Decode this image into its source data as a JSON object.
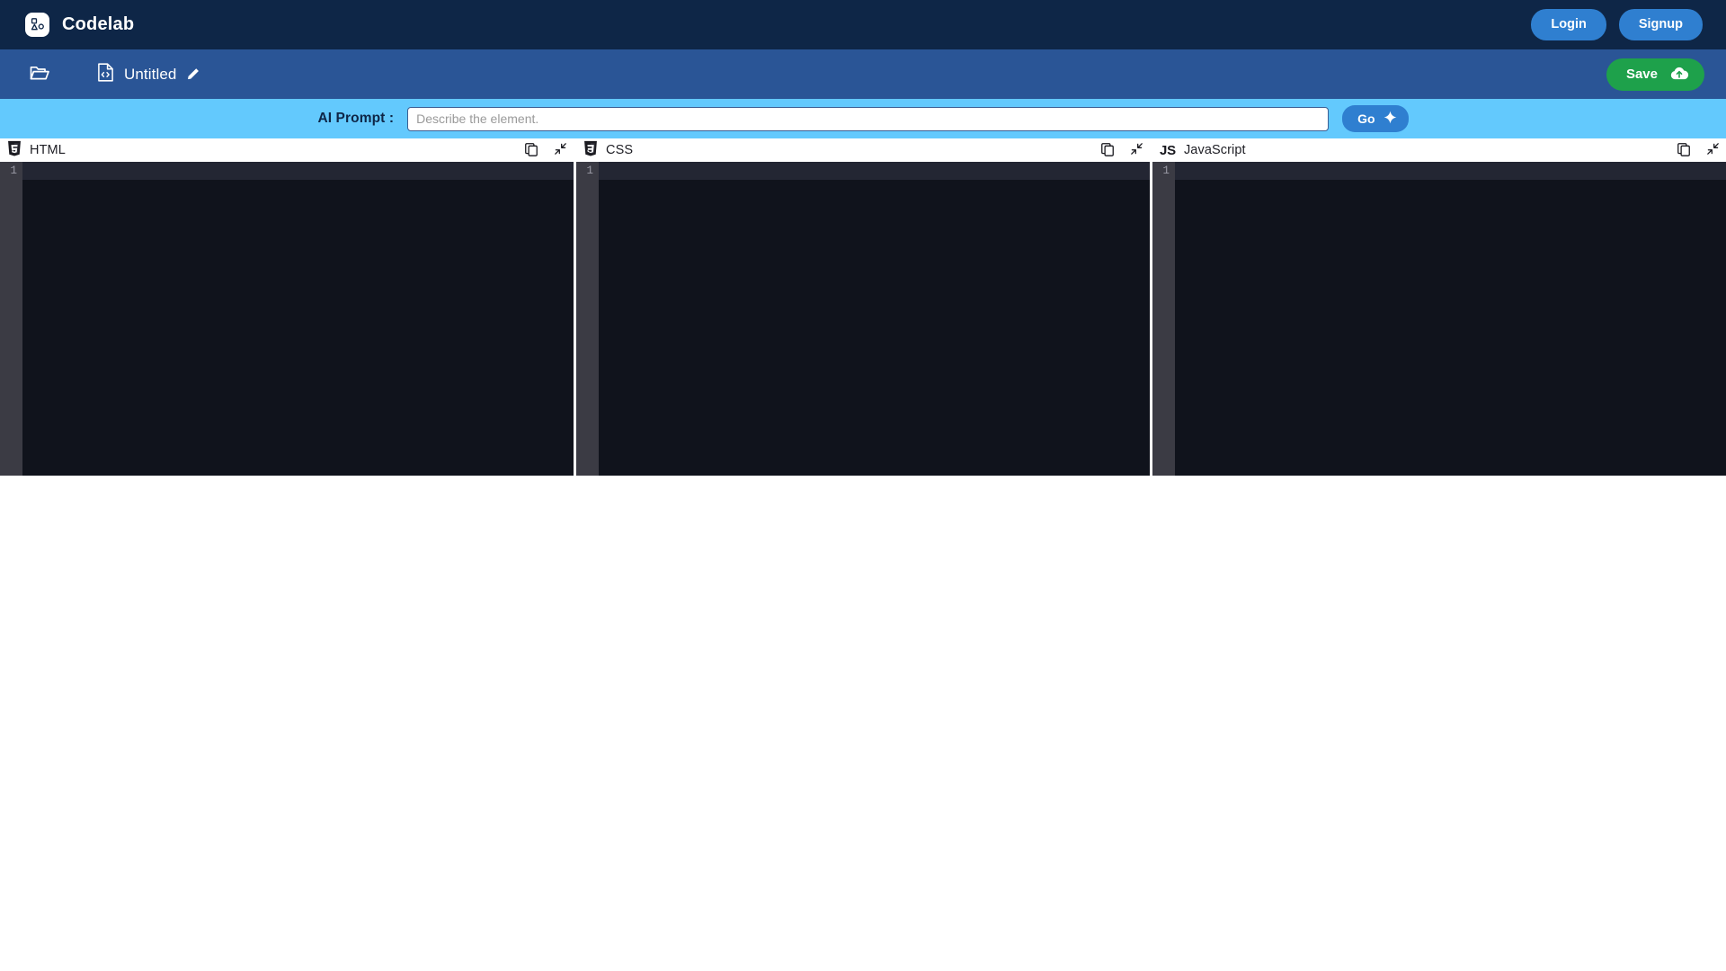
{
  "theme": {
    "topbar_bg": "#0e2647",
    "filebar_bg": "#2a5596",
    "promptbar_bg": "#63c9fd",
    "accent_blue": "#2f7fd0",
    "save_green": "#1ea14b",
    "editor_bg": "#10131c",
    "gutter_bg": "#3b3b44",
    "active_line": "#232633"
  },
  "topbar": {
    "logo_icon": "codelab-shapes-icon",
    "brand": "Codelab",
    "login_label": "Login",
    "signup_label": "Signup"
  },
  "filebar": {
    "folder_icon": "folder-open-icon",
    "file_icon": "code-file-icon",
    "file_name": "Untitled",
    "edit_icon": "pencil-icon",
    "save_label": "Save",
    "save_icon": "cloud-upload-icon"
  },
  "prompt": {
    "label": "AI Prompt :",
    "placeholder": "Describe the element.",
    "value": "",
    "go_label": "Go",
    "go_icon": "sparkle-icon"
  },
  "panels": [
    {
      "id": "html",
      "title": "HTML",
      "logo_icon": "html5-shield-icon",
      "copy_icon": "copy-icon",
      "collapse_icon": "collapse-arrows-icon",
      "line_numbers": "1",
      "code": ""
    },
    {
      "id": "css",
      "title": "CSS",
      "logo_icon": "css3-shield-icon",
      "copy_icon": "copy-icon",
      "collapse_icon": "collapse-arrows-icon",
      "line_numbers": "1",
      "code": ""
    },
    {
      "id": "javascript",
      "title": "JavaScript",
      "logo_icon": "js-mark-icon",
      "logo_text": "JS",
      "copy_icon": "copy-icon",
      "collapse_icon": "collapse-arrows-icon",
      "line_numbers": "1",
      "code": ""
    }
  ]
}
